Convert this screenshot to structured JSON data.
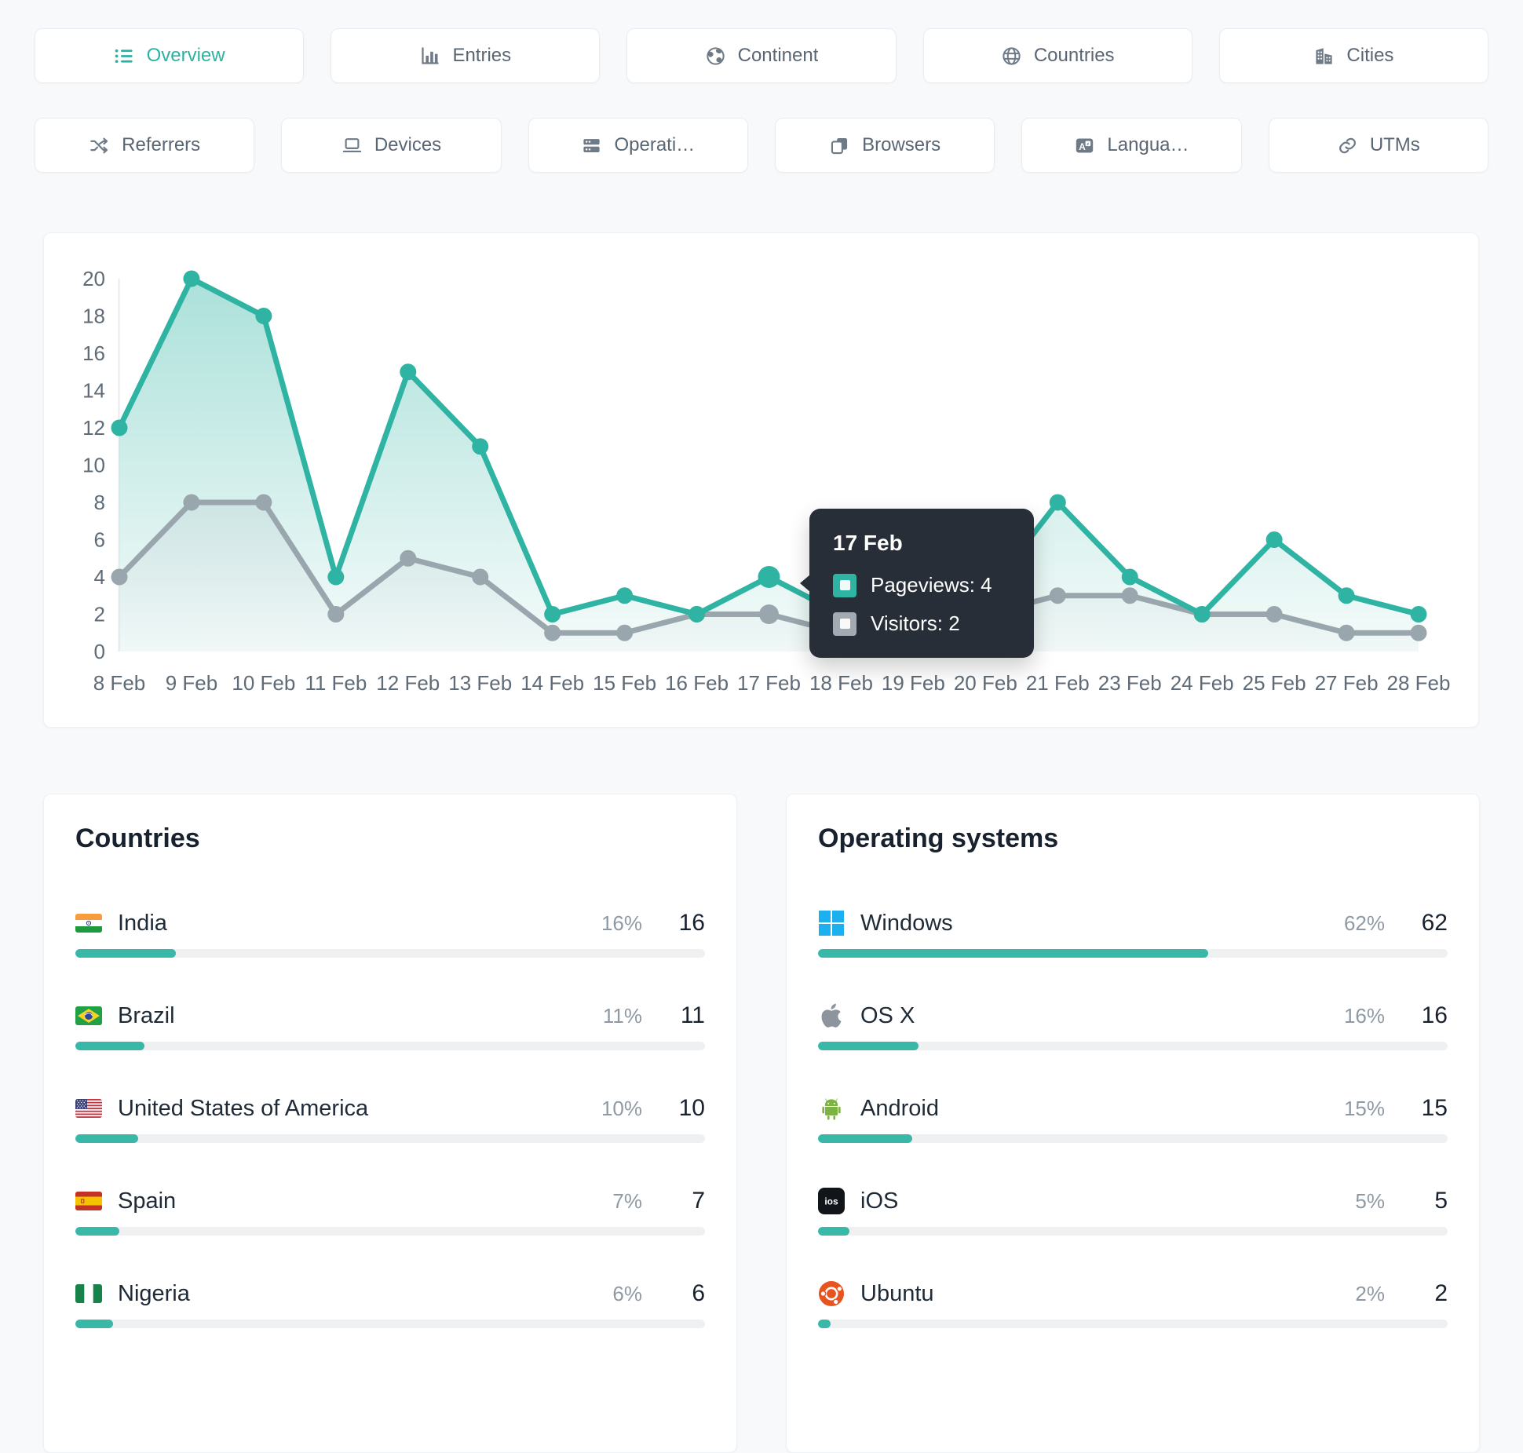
{
  "colors": {
    "accent": "#2bb3a2",
    "pageviews_line": "#2fb3a3",
    "visitors_line": "#9aa6ad",
    "tooltip_bg": "#272e38",
    "bar_fill": "#39b8a8",
    "bar_track": "#eef0f2",
    "axis_text": "#5f6b76",
    "page_bg": "#f7f9fb"
  },
  "tabs_row1": [
    {
      "label": "Overview",
      "icon": "list-icon",
      "active": true
    },
    {
      "label": "Entries",
      "icon": "bar-chart-icon",
      "active": false
    },
    {
      "label": "Continent",
      "icon": "earth-icon",
      "active": false
    },
    {
      "label": "Countries",
      "icon": "globe-icon",
      "active": false
    },
    {
      "label": "Cities",
      "icon": "buildings-icon",
      "active": false
    }
  ],
  "tabs_row2": [
    {
      "label": "Referrers",
      "icon": "shuffle-icon",
      "active": false
    },
    {
      "label": "Devices",
      "icon": "laptop-icon",
      "active": false
    },
    {
      "label": "Operati…",
      "icon": "server-icon",
      "active": false
    },
    {
      "label": "Browsers",
      "icon": "windows-app-icon",
      "active": false
    },
    {
      "label": "Langua…",
      "icon": "translate-icon",
      "active": false
    },
    {
      "label": "UTMs",
      "icon": "link-icon",
      "active": false
    }
  ],
  "chart_data": {
    "type": "line",
    "x": [
      "8 Feb",
      "9 Feb",
      "10 Feb",
      "11 Feb",
      "12 Feb",
      "13 Feb",
      "14 Feb",
      "15 Feb",
      "16 Feb",
      "17 Feb",
      "18 Feb",
      "19 Feb",
      "20 Feb",
      "21 Feb",
      "23 Feb",
      "24 Feb",
      "25 Feb",
      "27 Feb",
      "28 Feb"
    ],
    "series": [
      {
        "name": "Pageviews",
        "color": "#2fb3a3",
        "values": [
          12,
          20,
          18,
          4,
          15,
          11,
          2,
          3,
          2,
          4,
          2,
          2,
          3,
          8,
          4,
          2,
          6,
          3,
          2
        ]
      },
      {
        "name": "Visitors",
        "color": "#9aa6ad",
        "values": [
          4,
          8,
          8,
          2,
          5,
          4,
          1,
          1,
          2,
          2,
          1,
          1,
          2,
          3,
          3,
          2,
          2,
          1,
          1
        ]
      }
    ],
    "ylim": [
      0,
      20
    ],
    "ytick_step": 2,
    "grid": false,
    "legend_position": "tooltip-only",
    "hover_index": 9
  },
  "tooltip": {
    "date": "17 Feb",
    "rows": [
      {
        "text": "Pageviews: 4",
        "color": "#2fb3a3"
      },
      {
        "text": "Visitors: 2",
        "color": "#a2aab2"
      }
    ]
  },
  "panels": [
    {
      "title": "Countries",
      "rows": [
        {
          "icon": "flag-india",
          "name": "India",
          "percent": "16%",
          "value": 16
        },
        {
          "icon": "flag-brazil",
          "name": "Brazil",
          "percent": "11%",
          "value": 11
        },
        {
          "icon": "flag-usa",
          "name": "United States of America",
          "percent": "10%",
          "value": 10
        },
        {
          "icon": "flag-spain",
          "name": "Spain",
          "percent": "7%",
          "value": 7
        },
        {
          "icon": "flag-nigeria",
          "name": "Nigeria",
          "percent": "6%",
          "value": 6
        }
      ]
    },
    {
      "title": "Operating systems",
      "rows": [
        {
          "icon": "windows-logo",
          "name": "Windows",
          "percent": "62%",
          "value": 62
        },
        {
          "icon": "apple-logo",
          "name": "OS X",
          "percent": "16%",
          "value": 16
        },
        {
          "icon": "android-logo",
          "name": "Android",
          "percent": "15%",
          "value": 15
        },
        {
          "icon": "ios-logo",
          "name": "iOS",
          "percent": "5%",
          "value": 5
        },
        {
          "icon": "ubuntu-logo",
          "name": "Ubuntu",
          "percent": "2%",
          "value": 2
        }
      ]
    }
  ]
}
